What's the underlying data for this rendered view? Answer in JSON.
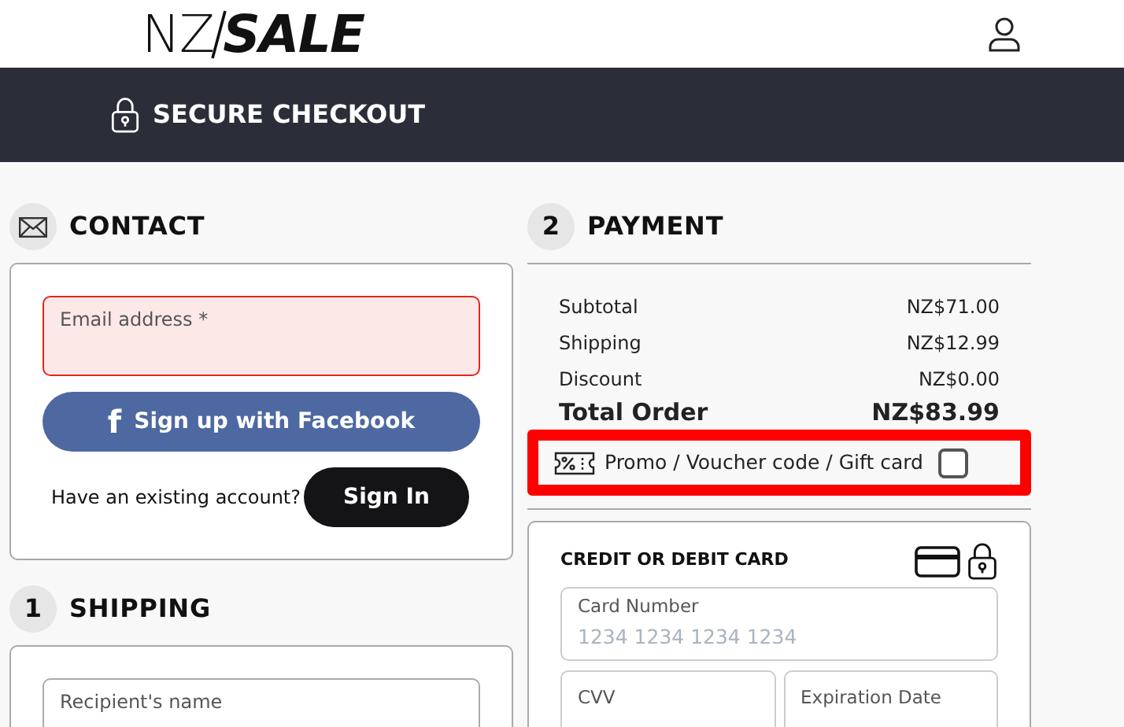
{
  "header": {
    "logo": {
      "light": "NZ",
      "bold": "SALE"
    }
  },
  "banner": {
    "title": "SECURE CHECKOUT"
  },
  "contact": {
    "title": "CONTACT",
    "email": {
      "placeholder": "Email address *",
      "error": true
    },
    "facebook_button": {
      "icon": "f",
      "label": "Sign up with Facebook"
    },
    "account_prompt": "Have an existing account?",
    "sign_in_button": "Sign In"
  },
  "shipping": {
    "step": "1",
    "title": "SHIPPING",
    "recipient": {
      "placeholder": "Recipient's name"
    }
  },
  "payment": {
    "step": "2",
    "title": "PAYMENT",
    "summary": [
      {
        "label": "Subtotal",
        "value": "NZ$71.00",
        "kind": "line"
      },
      {
        "label": "Shipping",
        "value": "NZ$12.99",
        "kind": "line"
      },
      {
        "label": "Discount",
        "value": "NZ$0.00",
        "kind": "line"
      },
      {
        "label": "Total Order",
        "value": "NZ$83.99",
        "kind": "total"
      }
    ],
    "promo": {
      "label": "Promo / Voucher code / Gift card",
      "checked": false,
      "highlighted": true
    },
    "card": {
      "title": "CREDIT OR DEBIT CARD",
      "number": {
        "label": "Card Number",
        "placeholder": "1234 1234 1234 1234"
      },
      "cvv": {
        "label": "CVV"
      },
      "expiry": {
        "label": "Expiration Date"
      }
    }
  }
}
